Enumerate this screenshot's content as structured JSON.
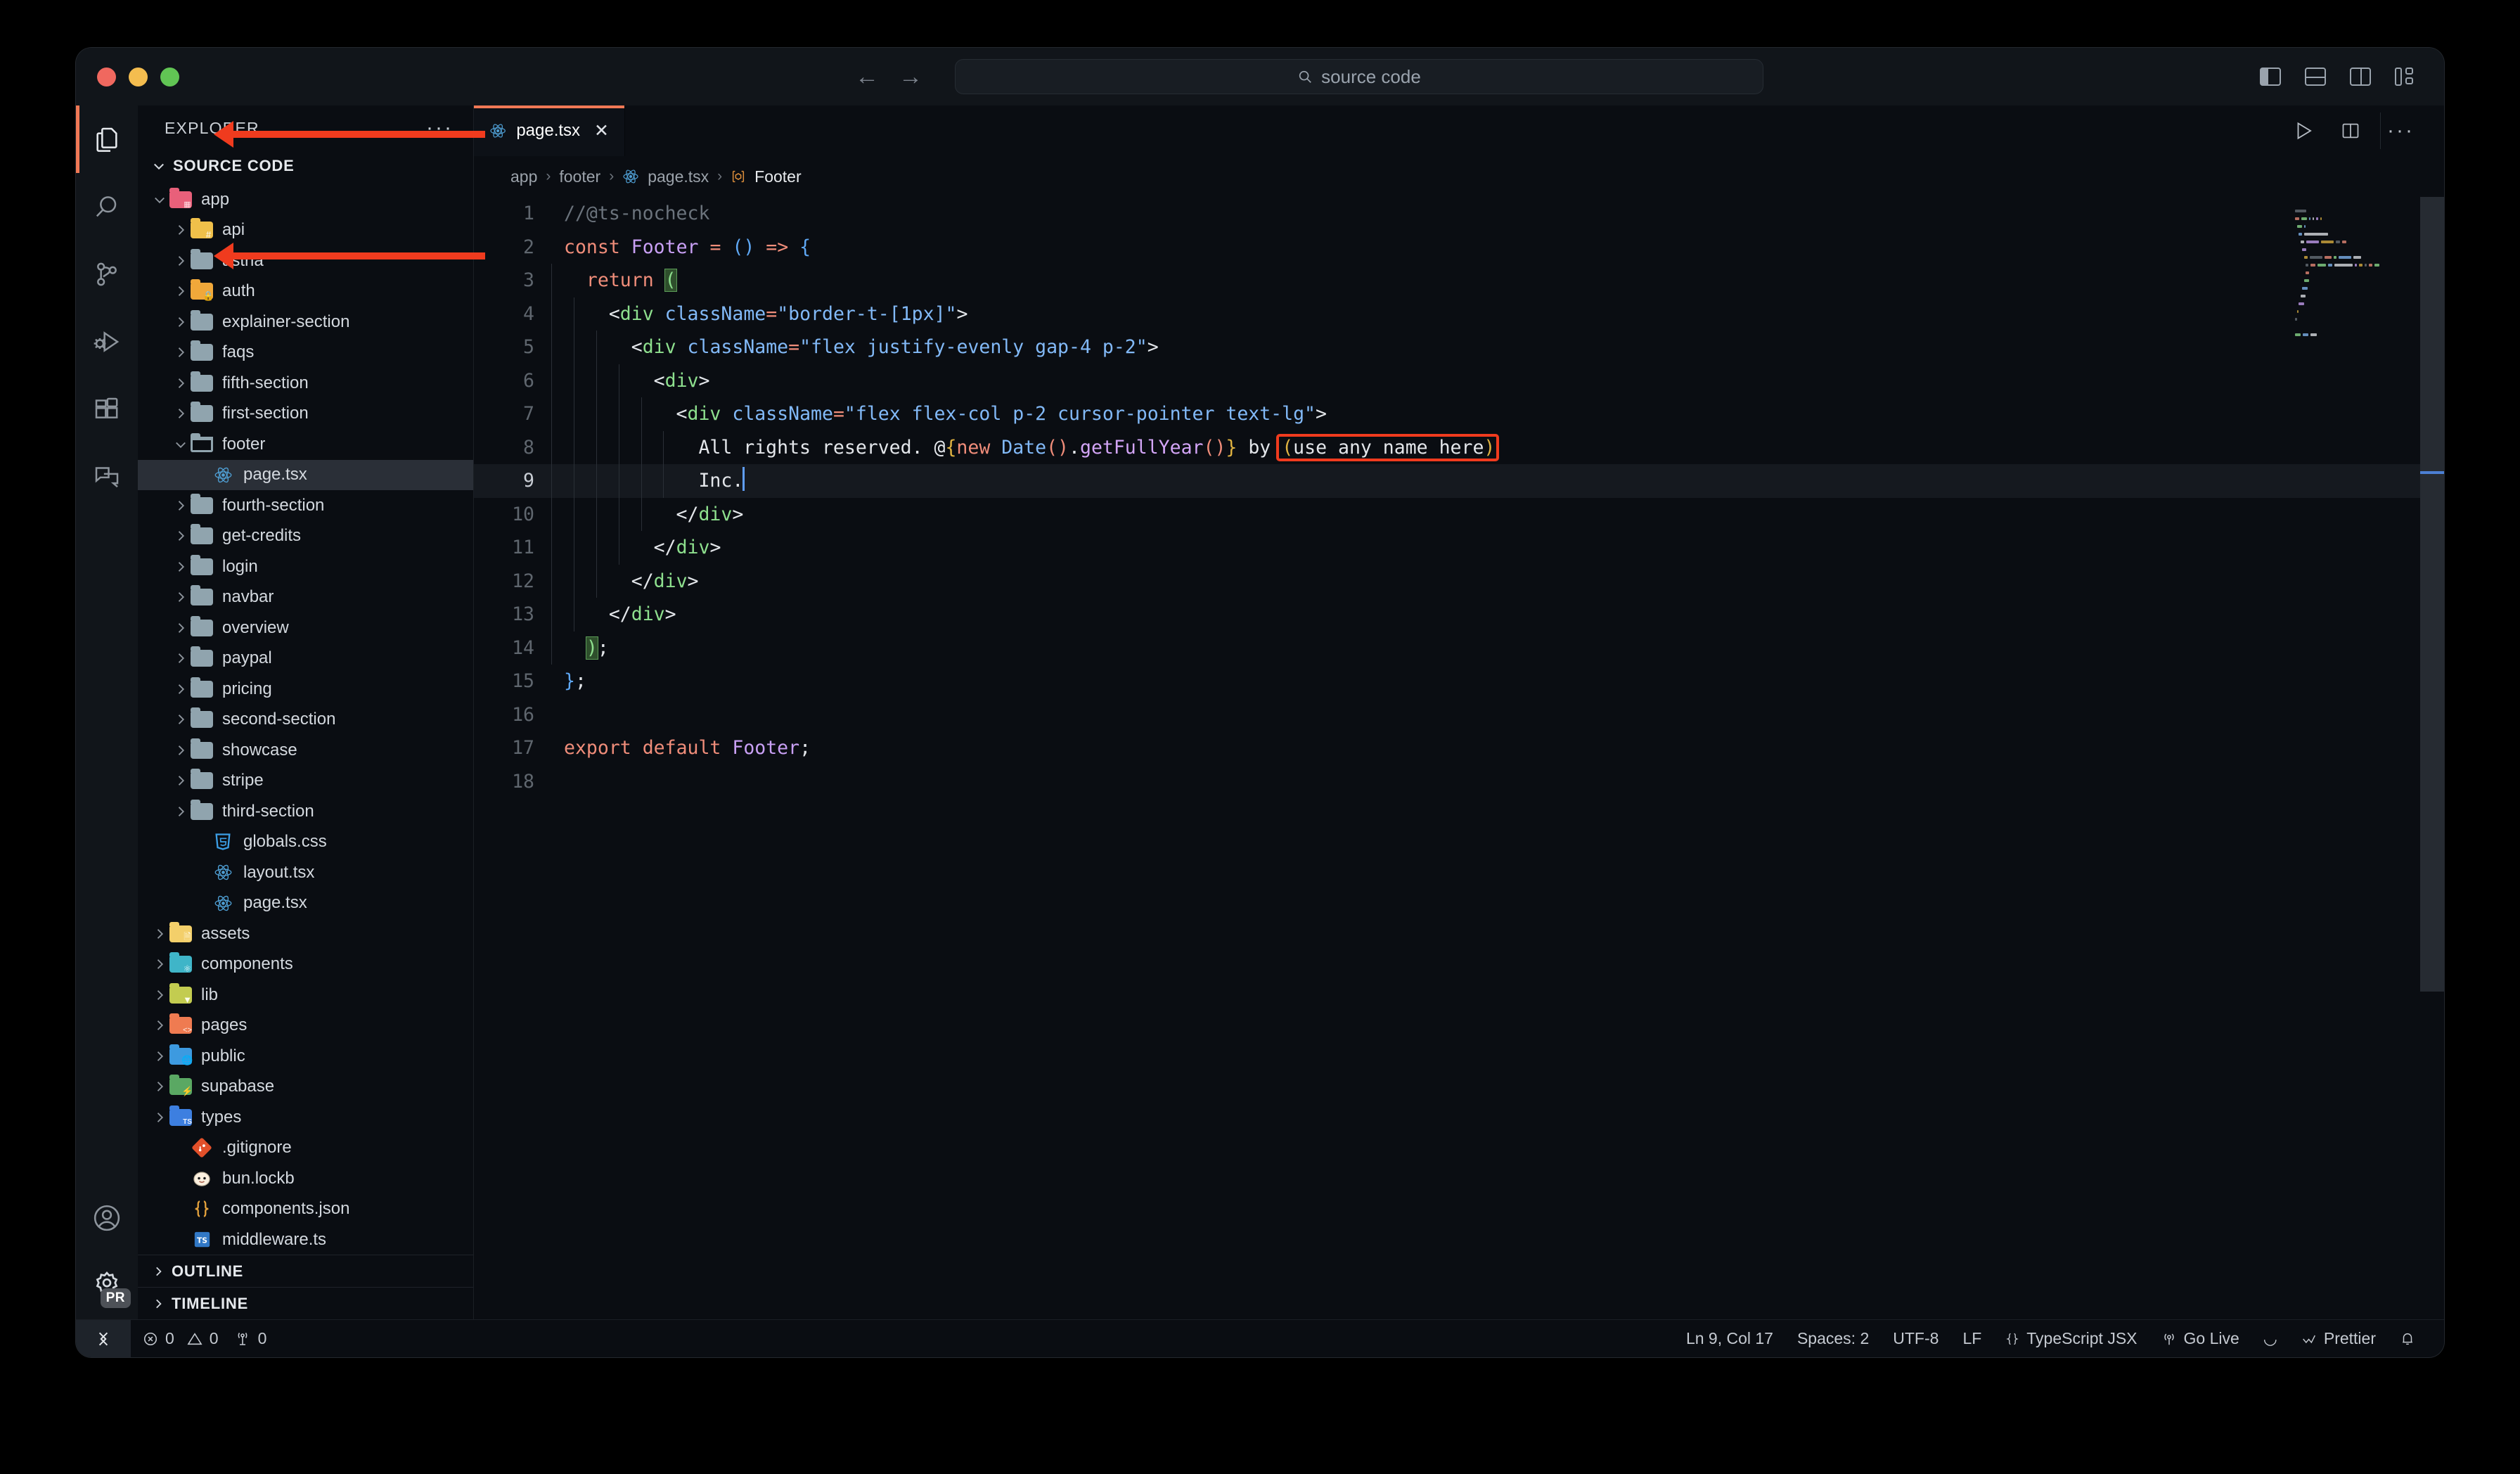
{
  "window": {
    "traffic_lights": [
      "close",
      "minimize",
      "maximize"
    ],
    "search_placeholder": "source code",
    "nav_back": "←",
    "nav_forward": "→"
  },
  "activitybar": {
    "items": [
      {
        "name": "explorer",
        "icon": "files-icon",
        "active": true
      },
      {
        "name": "search",
        "icon": "search-icon",
        "active": false
      },
      {
        "name": "source-control",
        "icon": "source-control-icon",
        "active": false
      },
      {
        "name": "run-and-debug",
        "icon": "debug-icon",
        "active": false
      },
      {
        "name": "extensions",
        "icon": "extensions-icon",
        "active": false
      },
      {
        "name": "chat",
        "icon": "chat-icon",
        "active": false
      }
    ],
    "bottom": [
      {
        "name": "accounts",
        "icon": "account-icon"
      },
      {
        "name": "settings",
        "icon": "gear-icon",
        "badge": "PR"
      }
    ]
  },
  "sidebar": {
    "title": "EXPLORER",
    "more_actions": "···",
    "root_label": "SOURCE CODE",
    "outline_label": "OUTLINE",
    "timeline_label": "TIMELINE",
    "tree": [
      {
        "label": "app",
        "depth": 1,
        "type": "folder",
        "icon": "folder-app",
        "expanded": true,
        "color": "#e8607a"
      },
      {
        "label": "api",
        "depth": 2,
        "type": "folder",
        "icon": "folder-api",
        "expanded": false,
        "color": "#f0c04a"
      },
      {
        "label": "astria",
        "depth": 2,
        "type": "folder",
        "icon": "folder-plain",
        "expanded": false,
        "color": "#90a4ae"
      },
      {
        "label": "auth",
        "depth": 2,
        "type": "folder",
        "icon": "folder-auth",
        "expanded": false,
        "color": "#f0a83a"
      },
      {
        "label": "explainer-section",
        "depth": 2,
        "type": "folder",
        "icon": "folder-plain",
        "expanded": false,
        "color": "#90a4ae"
      },
      {
        "label": "faqs",
        "depth": 2,
        "type": "folder",
        "icon": "folder-plain",
        "expanded": false,
        "color": "#90a4ae"
      },
      {
        "label": "fifth-section",
        "depth": 2,
        "type": "folder",
        "icon": "folder-plain",
        "expanded": false,
        "color": "#90a4ae"
      },
      {
        "label": "first-section",
        "depth": 2,
        "type": "folder",
        "icon": "folder-plain",
        "expanded": false,
        "color": "#90a4ae"
      },
      {
        "label": "footer",
        "depth": 2,
        "type": "folder",
        "icon": "folder-open",
        "expanded": true,
        "color": "#90a4ae"
      },
      {
        "label": "page.tsx",
        "depth": 3,
        "type": "file",
        "icon": "react-icon",
        "selected": true,
        "color": "#4f9fd4"
      },
      {
        "label": "fourth-section",
        "depth": 2,
        "type": "folder",
        "icon": "folder-plain",
        "expanded": false,
        "color": "#90a4ae"
      },
      {
        "label": "get-credits",
        "depth": 2,
        "type": "folder",
        "icon": "folder-plain",
        "expanded": false,
        "color": "#90a4ae"
      },
      {
        "label": "login",
        "depth": 2,
        "type": "folder",
        "icon": "folder-plain",
        "expanded": false,
        "color": "#90a4ae"
      },
      {
        "label": "navbar",
        "depth": 2,
        "type": "folder",
        "icon": "folder-plain",
        "expanded": false,
        "color": "#90a4ae"
      },
      {
        "label": "overview",
        "depth": 2,
        "type": "folder",
        "icon": "folder-plain",
        "expanded": false,
        "color": "#90a4ae"
      },
      {
        "label": "paypal",
        "depth": 2,
        "type": "folder",
        "icon": "folder-plain",
        "expanded": false,
        "color": "#90a4ae"
      },
      {
        "label": "pricing",
        "depth": 2,
        "type": "folder",
        "icon": "folder-plain",
        "expanded": false,
        "color": "#90a4ae"
      },
      {
        "label": "second-section",
        "depth": 2,
        "type": "folder",
        "icon": "folder-plain",
        "expanded": false,
        "color": "#90a4ae"
      },
      {
        "label": "showcase",
        "depth": 2,
        "type": "folder",
        "icon": "folder-plain",
        "expanded": false,
        "color": "#90a4ae"
      },
      {
        "label": "stripe",
        "depth": 2,
        "type": "folder",
        "icon": "folder-plain",
        "expanded": false,
        "color": "#90a4ae"
      },
      {
        "label": "third-section",
        "depth": 2,
        "type": "folder",
        "icon": "folder-plain",
        "expanded": false,
        "color": "#90a4ae"
      },
      {
        "label": "globals.css",
        "depth": 3,
        "type": "file",
        "icon": "css-icon",
        "color": "#3c9ee5"
      },
      {
        "label": "layout.tsx",
        "depth": 3,
        "type": "file",
        "icon": "react-icon",
        "color": "#4f9fd4"
      },
      {
        "label": "page.tsx",
        "depth": 3,
        "type": "file",
        "icon": "react-icon",
        "color": "#4f9fd4"
      },
      {
        "label": "assets",
        "depth": 1,
        "type": "folder",
        "icon": "folder-assets",
        "expanded": false,
        "color": "#f3cf6a"
      },
      {
        "label": "components",
        "depth": 1,
        "type": "folder",
        "icon": "folder-react",
        "expanded": false,
        "color": "#3fb5c8"
      },
      {
        "label": "lib",
        "depth": 1,
        "type": "folder",
        "icon": "folder-lib",
        "expanded": false,
        "color": "#c3cc50"
      },
      {
        "label": "pages",
        "depth": 1,
        "type": "folder",
        "icon": "folder-pages",
        "expanded": false,
        "color": "#ef7b51"
      },
      {
        "label": "public",
        "depth": 1,
        "type": "folder",
        "icon": "folder-public",
        "expanded": false,
        "color": "#3d9ae0"
      },
      {
        "label": "supabase",
        "depth": 1,
        "type": "folder",
        "icon": "folder-supabase",
        "expanded": false,
        "color": "#5aa863"
      },
      {
        "label": "types",
        "depth": 1,
        "type": "folder",
        "icon": "folder-types",
        "expanded": false,
        "color": "#3d7fe0"
      },
      {
        "label": ".gitignore",
        "depth": 2,
        "type": "file",
        "icon": "git-icon",
        "color": "#e2502a"
      },
      {
        "label": "bun.lockb",
        "depth": 2,
        "type": "file",
        "icon": "bun-icon",
        "color": "#fbf0df"
      },
      {
        "label": "components.json",
        "depth": 2,
        "type": "file",
        "icon": "json-icon",
        "color": "#e3a13c"
      },
      {
        "label": "middleware.ts",
        "depth": 2,
        "type": "file",
        "icon": "ts-icon",
        "color": "#3178c6"
      }
    ]
  },
  "tabs": [
    {
      "label": "page.tsx",
      "icon": "react-icon",
      "close": "✕",
      "active": true
    }
  ],
  "tab_actions": [
    "run-icon",
    "split-editor-icon",
    "more-actions-icon"
  ],
  "breadcrumb": {
    "items": [
      "app",
      "footer",
      "page.tsx",
      "Footer"
    ],
    "separator": "›"
  },
  "code": {
    "lines": [
      {
        "n": 1,
        "indents": 0
      },
      {
        "n": 2,
        "indents": 0
      },
      {
        "n": 3,
        "indents": 1
      },
      {
        "n": 4,
        "indents": 2
      },
      {
        "n": 5,
        "indents": 3
      },
      {
        "n": 6,
        "indents": 4
      },
      {
        "n": 7,
        "indents": 5
      },
      {
        "n": 8,
        "indents": 6
      },
      {
        "n": 9,
        "indents": 6,
        "current": true
      },
      {
        "n": 10,
        "indents": 5
      },
      {
        "n": 11,
        "indents": 4
      },
      {
        "n": 12,
        "indents": 3
      },
      {
        "n": 13,
        "indents": 2
      },
      {
        "n": 14,
        "indents": 1
      },
      {
        "n": 15,
        "indents": 0
      },
      {
        "n": 16,
        "indents": 0
      },
      {
        "n": 17,
        "indents": 0
      },
      {
        "n": 18,
        "indents": 0
      }
    ],
    "text": [
      "//@ts-nocheck",
      "const Footer = () => {",
      "  return (",
      "    <div className=\"border-t-[1px]\">",
      "      <div className=\"flex justify-evenly gap-4 p-2\">",
      "        <div>",
      "          <div className=\"flex flex-col p-2 cursor-pointer text-lg\">",
      "            All rights reserved. @{new Date().getFullYear()} by (use any name here)",
      "            Inc.",
      "          </div>",
      "        </div>",
      "      </div>",
      "    </div>",
      "  );",
      "};",
      "",
      "export default Footer;",
      ""
    ]
  },
  "annotations": {
    "highlight_text": "(use any name here)",
    "highlight_color": "#f03b1e",
    "arrow_targets": [
      "app",
      "page.tsx"
    ]
  },
  "statusbar": {
    "remote_icon": "remote-window-icon",
    "errors": "0",
    "warnings": "0",
    "ports": "0",
    "cursor_position": "Ln 9, Col 17",
    "indentation": "Spaces: 2",
    "encoding": "UTF-8",
    "eol": "LF",
    "language": "TypeScript JSX",
    "go_live": "Go Live",
    "spinner": "◡",
    "formatter": "Prettier",
    "notifications": "bell-icon"
  }
}
